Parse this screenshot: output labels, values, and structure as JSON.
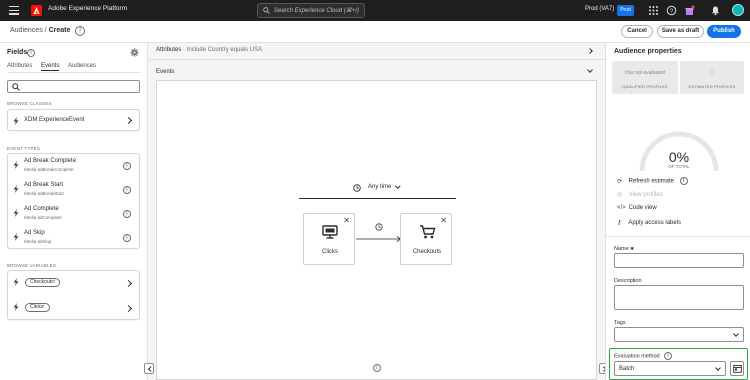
{
  "topbar": {
    "brand": "Adobe Experience Platform",
    "search_placeholder": "Search Experience Cloud (⌘+/)",
    "org": "Prod (VA7)",
    "sandbox": "Prod"
  },
  "header": {
    "crumb_parent": "Audiences",
    "crumb_sep": "/",
    "crumb_current": "Create",
    "cancel": "Cancel",
    "save_draft": "Save as draft",
    "publish": "Publish"
  },
  "fields": {
    "title": "Fields",
    "tabs": [
      "Attributes",
      "Events",
      "Audiences"
    ],
    "selected_tab": "Events",
    "search_value": "",
    "browse_classes_header": "BROWSE CLASSES",
    "classes": [
      {
        "name": "XDM ExperienceEvent"
      }
    ],
    "event_types_header": "EVENT TYPES",
    "event_types": [
      {
        "name": "Ad Break Complete",
        "sub": "Media adBreakComplete"
      },
      {
        "name": "Ad Break Start",
        "sub": "Media adBreakStart"
      },
      {
        "name": "Ad Complete",
        "sub": "Media adComplete"
      },
      {
        "name": "Ad Skip",
        "sub": "Media adSkip"
      }
    ],
    "browse_variables_header": "BROWSE VARIABLES",
    "variables": [
      {
        "name": "Checkouts"
      },
      {
        "name": "Clicks"
      }
    ]
  },
  "canvas": {
    "attributes_label": "Attributes",
    "attributes_summary": "Include Country equals USA",
    "events_label": "Events",
    "time_label": "Any time",
    "nodes": [
      {
        "label": "Clicks"
      },
      {
        "label": "Checkouts"
      }
    ]
  },
  "properties": {
    "title": "Audience properties",
    "qualified_value": "Has not evaluated",
    "qualified_label": "QUALIFIED PROFILES",
    "estimated_value": "0",
    "estimated_label": "ESTIMATED PROFILES",
    "percent": "0%",
    "percent_label": "OF TOTAL",
    "refresh": "Refresh estimate",
    "view_profiles": "View profiles",
    "code_view": "Code view",
    "access_labels": "Apply access labels",
    "name_label": "Name",
    "name_required": "✱",
    "name_value": "",
    "description_label": "Description",
    "description_value": "",
    "tags_label": "Tags",
    "tags_value": "",
    "eval_label": "Evaluation method",
    "eval_value": "Batch",
    "highlight_color": "#2da44e",
    "accent_color": "#1473e6"
  }
}
